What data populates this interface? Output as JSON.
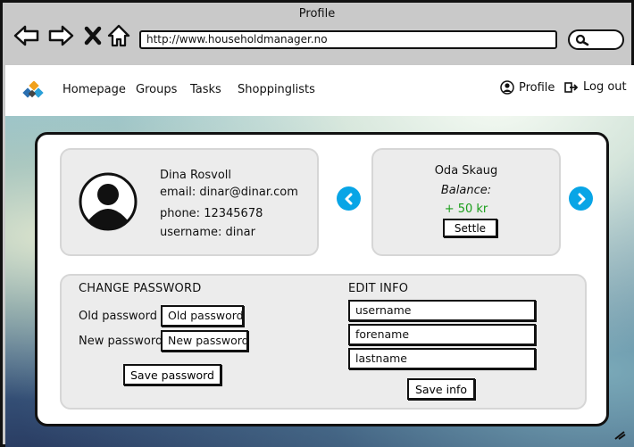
{
  "browser": {
    "title": "Profile",
    "url": "http://www.householdmanager.no",
    "back_icon": "arrow-left-icon",
    "forward_icon": "arrow-right-icon",
    "stop_icon": "close-icon",
    "home_icon": "home-icon",
    "search_icon": "search-icon"
  },
  "nav": {
    "logo_icon": "app-logo-icon",
    "links": [
      "Homepage",
      "Groups",
      "Tasks",
      "Shoppinglists"
    ],
    "profile_label": "Profile",
    "logout_label": "Log out"
  },
  "profile": {
    "name": "Dina Rosvoll",
    "email": "email: dinar@dinar.com",
    "phone": "phone: 12345678",
    "username": "username: dinar"
  },
  "balance": {
    "person": "Oda Skaug",
    "label": "Balance:",
    "amount": "+ 50 kr",
    "settle_label": "Settle",
    "amount_color": "#1a9e1a"
  },
  "change_password": {
    "title": "CHANGE PASSWORD",
    "old_label": "Old password",
    "old_placeholder": "Old password",
    "new_label": "New password",
    "new_placeholder": "New password",
    "save_label": "Save password"
  },
  "edit_info": {
    "title": "EDIT INFO",
    "fields": [
      "username",
      "forename",
      "lastname"
    ],
    "save_label": "Save info"
  },
  "colors": {
    "accent": "#08a5e6",
    "panel": "#ececec"
  }
}
